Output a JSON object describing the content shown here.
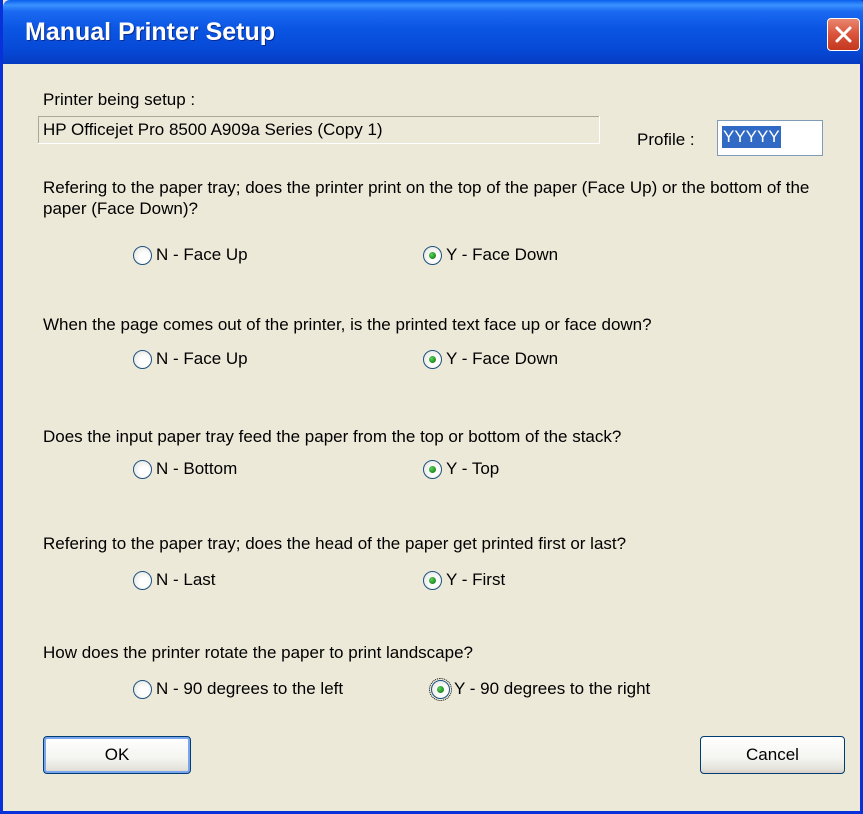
{
  "window": {
    "title": "Manual Printer Setup"
  },
  "printer": {
    "label": "Printer being setup :",
    "name": "HP Officejet Pro 8500 A909a Series (Copy 1)"
  },
  "profile": {
    "label": "Profile :",
    "value": "YYYYY"
  },
  "questions": [
    {
      "text": "Refering to the paper tray; does the printer print on the top of the paper (Face Up) or the bottom of the paper (Face Down)?",
      "option_n": "N - Face Up",
      "option_y": "Y - Face Down",
      "selected": "Y"
    },
    {
      "text": "When the page comes out of the printer, is the printed text face up or face down?",
      "option_n": "N - Face Up",
      "option_y": "Y - Face Down",
      "selected": "Y"
    },
    {
      "text": "Does the input paper tray feed the paper from the top or bottom of the stack?",
      "option_n": "N - Bottom",
      "option_y": "Y - Top",
      "selected": "Y"
    },
    {
      "text": "Refering to the paper tray; does the head of the paper get printed first or last?",
      "option_n": "N - Last",
      "option_y": "Y - First",
      "selected": "Y"
    },
    {
      "text": "How does the printer rotate the paper to print landscape?",
      "option_n": "N -  90 degrees to the left",
      "option_y": "Y - 90 degrees to the right",
      "selected": "Y"
    }
  ],
  "buttons": {
    "ok": "OK",
    "cancel": "Cancel"
  },
  "colors": {
    "titlebar": "#0a56e3",
    "dialog_background": "#ece9d8",
    "close_button": "#d9533a",
    "selection": "#316ac5",
    "radio_dot": "#21a121"
  },
  "icons": {
    "close": "close-icon"
  }
}
